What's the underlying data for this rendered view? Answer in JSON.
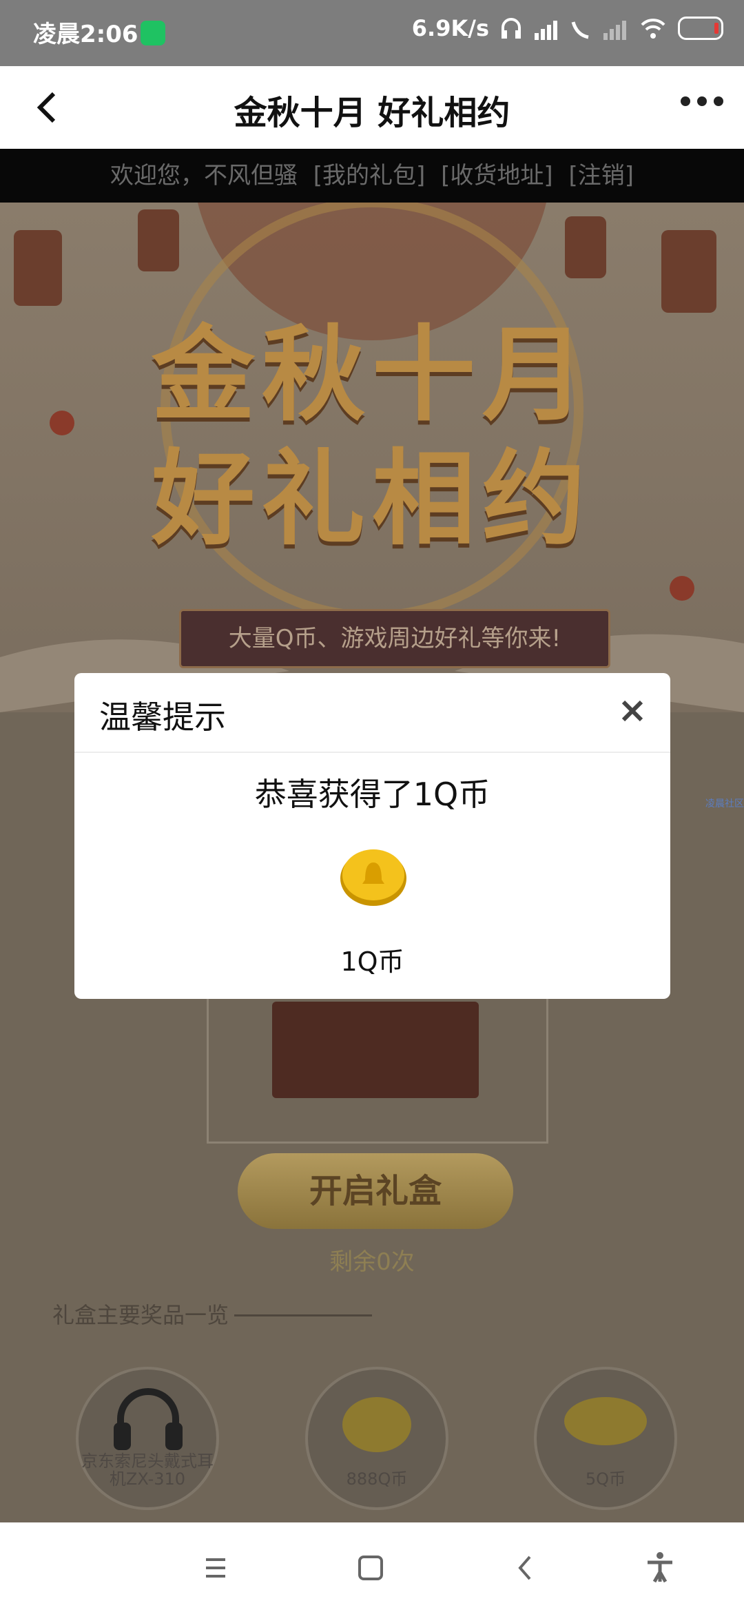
{
  "status_bar": {
    "time": "凌晨2:06",
    "net_speed": "6.9K/s"
  },
  "nav": {
    "title": "金秋十月 好礼相约"
  },
  "welcome_bar": {
    "greeting": "欢迎您，不风但骚",
    "links": [
      "[我的礼包]",
      "[收货地址]",
      "[注销]"
    ]
  },
  "hero": {
    "title_line1": "金秋十月",
    "title_line2": "好礼相约",
    "banner": "大量Q币、游戏周边好礼等你来!"
  },
  "main": {
    "open_button": "开启礼盒",
    "remaining": "剩余0次",
    "prize_heading": "礼盒主要奖品一览",
    "prizes": [
      {
        "label": "京东索尼头戴式耳机ZX-310"
      },
      {
        "label": "888Q币"
      },
      {
        "label": "5Q币"
      }
    ],
    "side_tag": "凌晨社区"
  },
  "modal": {
    "title": "温馨提示",
    "message": "恭喜获得了1Q币",
    "reward_label": "1Q币"
  },
  "colors": {
    "accent_gold": "#d4a52c",
    "wechat_green": "#1fc262"
  }
}
